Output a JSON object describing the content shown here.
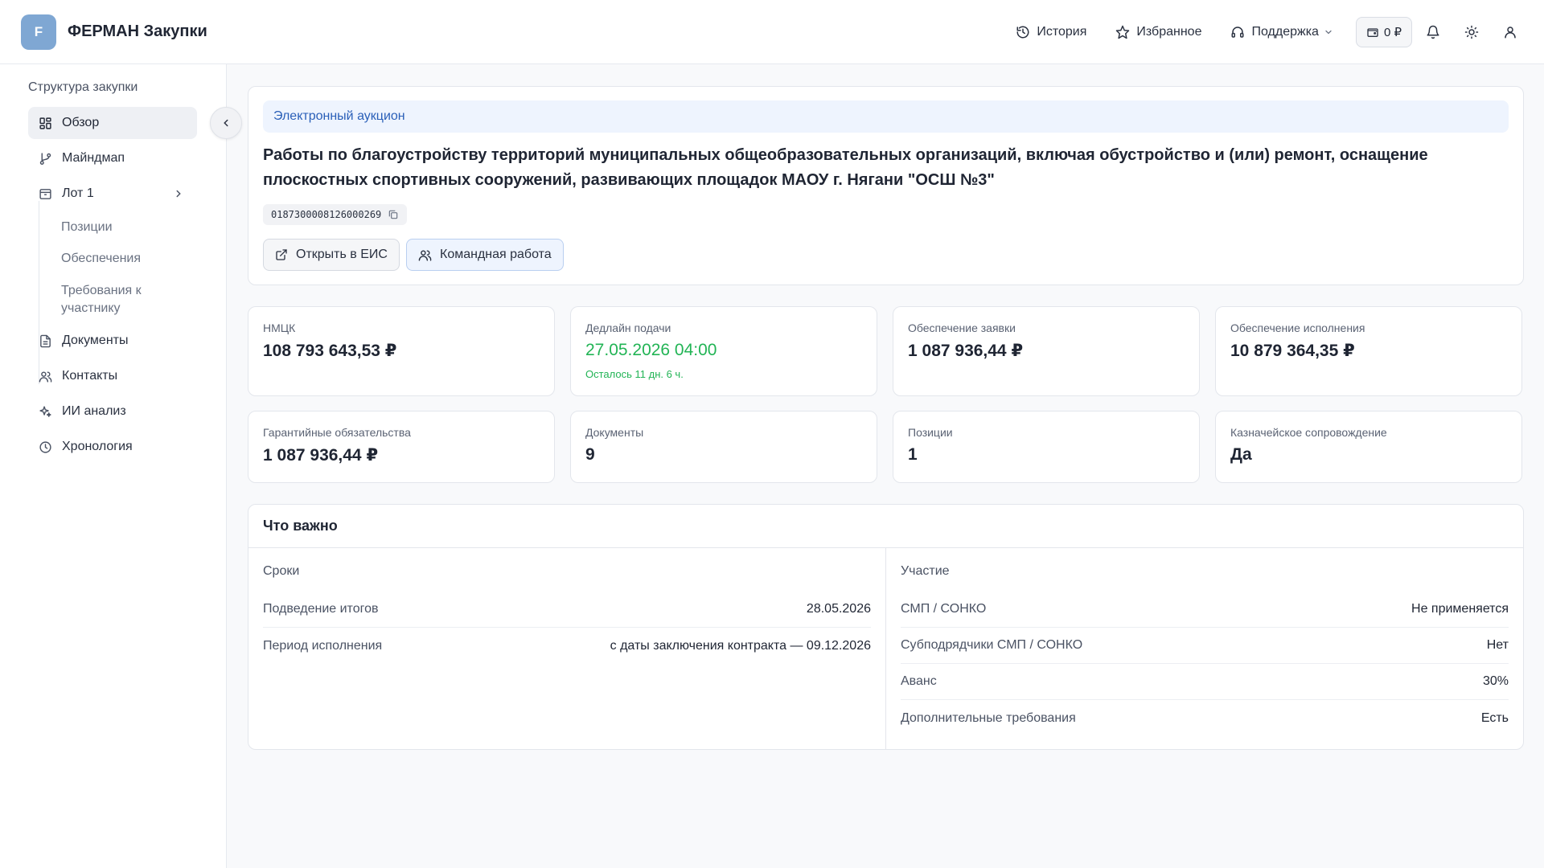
{
  "header": {
    "logo_letter": "F",
    "app_title": "ФЕРМАН Закупки",
    "nav": {
      "history": "История",
      "favorites": "Избранное",
      "support": "Поддержка"
    },
    "wallet_balance": "0 ₽"
  },
  "sidebar": {
    "title": "Структура закупки",
    "items": {
      "overview": "Обзор",
      "mindmap": "Майндмап",
      "lot": "Лот 1",
      "documents": "Документы",
      "contacts": "Контакты",
      "ai": "ИИ анализ",
      "timeline": "Хронология"
    },
    "sub_items": {
      "positions": "Позиции",
      "securities": "Обеспечения",
      "requirements": "Требования к участнику"
    }
  },
  "hero": {
    "tag": "Электронный аукцион",
    "title": "Работы по благоустройству территорий муниципальных общеобразовательных организаций, включая обустройство и (или) ремонт, оснащение плоскостных спортивных сооружений, развивающих площадок МАОУ г. Нягани \"ОСШ №3\"",
    "reg_number": "0187300008126000269",
    "open_eis": "Открыть в ЕИС",
    "team_work": "Командная работа"
  },
  "stats": {
    "nmck": {
      "label": "НМЦК",
      "value": "108 793 643,53 ₽"
    },
    "deadline": {
      "label": "Дедлайн подачи",
      "value": "27.05.2026 04:00",
      "remaining": "Осталось 11 дн. 6 ч."
    },
    "bid_security": {
      "label": "Обеспечение заявки",
      "value": "1 087 936,44 ₽"
    },
    "performance_security": {
      "label": "Обеспечение исполнения",
      "value": "10 879 364,35 ₽"
    },
    "warranty": {
      "label": "Гарантийные обязательства",
      "value": "1 087 936,44 ₽"
    },
    "documents": {
      "label": "Документы",
      "value": "9"
    },
    "positions": {
      "label": "Позиции",
      "value": "1"
    },
    "treasury": {
      "label": "Казначейское сопровождение",
      "value": "Да"
    }
  },
  "important": {
    "title": "Что важно",
    "terms": {
      "title": "Сроки",
      "rows": [
        {
          "k": "Подведение итогов",
          "v": "28.05.2026"
        },
        {
          "k": "Период исполнения",
          "v": "с даты заключения контракта — 09.12.2026"
        }
      ]
    },
    "participation": {
      "title": "Участие",
      "rows": [
        {
          "k": "СМП / СОНКО",
          "v": "Не применяется"
        },
        {
          "k": "Субподрядчики СМП / СОНКО",
          "v": "Нет"
        },
        {
          "k": "Аванс",
          "v": "30%"
        },
        {
          "k": "Дополнительные требования",
          "v": "Есть"
        }
      ]
    }
  },
  "colors": {
    "accent": "#2a5fb8",
    "success": "#22b455",
    "logo_bg": "#7fa7d3"
  }
}
